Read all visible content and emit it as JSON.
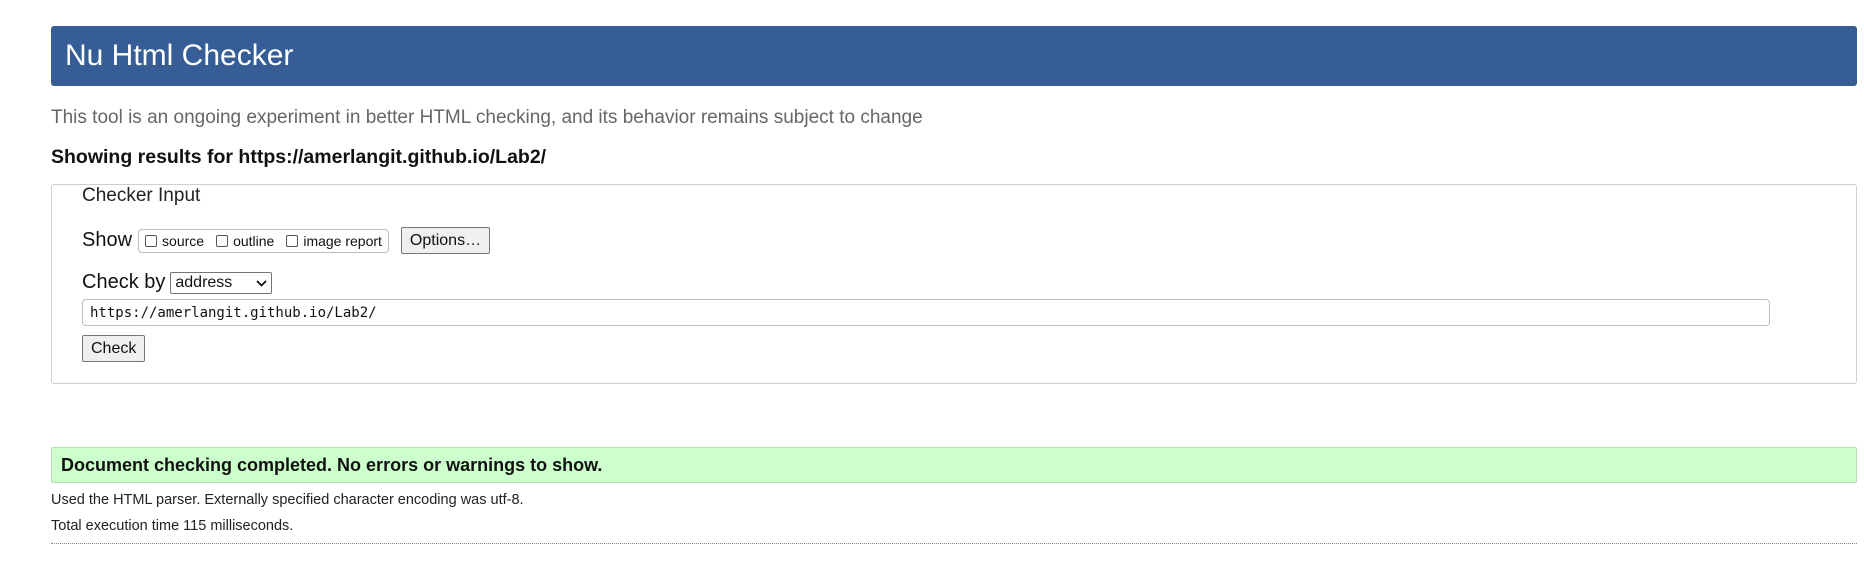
{
  "header": {
    "title": "Nu Html Checker"
  },
  "subtitle": "This tool is an ongoing experiment in better HTML checking, and its behavior remains subject to change",
  "results_for": "Showing results for https://amerlangit.github.io/Lab2/",
  "checker_input": {
    "legend": "Checker Input",
    "show_label": "Show",
    "show_options": [
      {
        "label": "source",
        "checked": false
      },
      {
        "label": "outline",
        "checked": false
      },
      {
        "label": "image report",
        "checked": false
      }
    ],
    "options_button": "Options…",
    "check_by_label": "Check by",
    "check_by_value": "address",
    "url_value": "https://amerlangit.github.io/Lab2/",
    "check_button": "Check"
  },
  "result": {
    "status": "Document checking completed. No errors or warnings to show.",
    "parser_note": "Used the HTML parser. Externally specified character encoding was utf-8.",
    "execution_time": "Total execution time 115 milliseconds."
  },
  "colors": {
    "header_bg": "#365d95",
    "success_bg": "#ccffcc"
  }
}
